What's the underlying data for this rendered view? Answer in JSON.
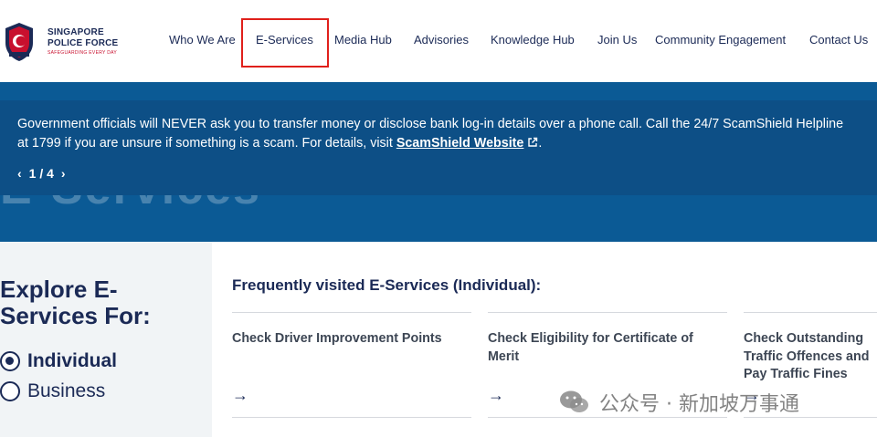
{
  "logo": {
    "line1": "SINGAPORE",
    "line2": "POLICE FORCE",
    "line3": "SAFEGUARDING EVERY DAY"
  },
  "nav": {
    "items": [
      {
        "label": "Who We Are"
      },
      {
        "label": "E-Services"
      },
      {
        "label": "Media Hub"
      },
      {
        "label": "Advisories"
      },
      {
        "label": "Knowledge Hub"
      },
      {
        "label": "Join Us"
      },
      {
        "label": "Community Engagement"
      },
      {
        "label": "Contact Us"
      }
    ]
  },
  "alert": {
    "line1": "Government officials will NEVER ask you to transfer money or disclose bank log-in details over a phone call. Call the 24/7 ScamShield Helpline",
    "line2_prefix": "at 1799 if you are unsure if something is a scam. For details, visit ",
    "link_label": "ScamShield Website",
    "line2_suffix": ".",
    "pager_prev": "‹",
    "pager_text": "1 / 4",
    "pager_next": "›"
  },
  "page": {
    "ghost_title": "E-Services"
  },
  "explore": {
    "title": "Explore E-Services For:",
    "options": [
      {
        "label": "Individual",
        "selected": true
      },
      {
        "label": "Business",
        "selected": false
      }
    ]
  },
  "services": {
    "section_title": "Frequently visited E-Services (Individual):",
    "cards": [
      {
        "title": "Check Driver Improvement Points",
        "arrow": "→"
      },
      {
        "title": "Check Eligibility for Certificate of Merit",
        "arrow": "→"
      },
      {
        "title": "Check Outstanding Traffic Offences and Pay Traffic Fines",
        "arrow": "→"
      }
    ]
  },
  "watermark": {
    "text": "公众号 · 新加坡万事通"
  },
  "colors": {
    "brand_navy": "#1b2a56",
    "banner_blue": "#0b5a95",
    "highlight_red": "#e0201b"
  }
}
